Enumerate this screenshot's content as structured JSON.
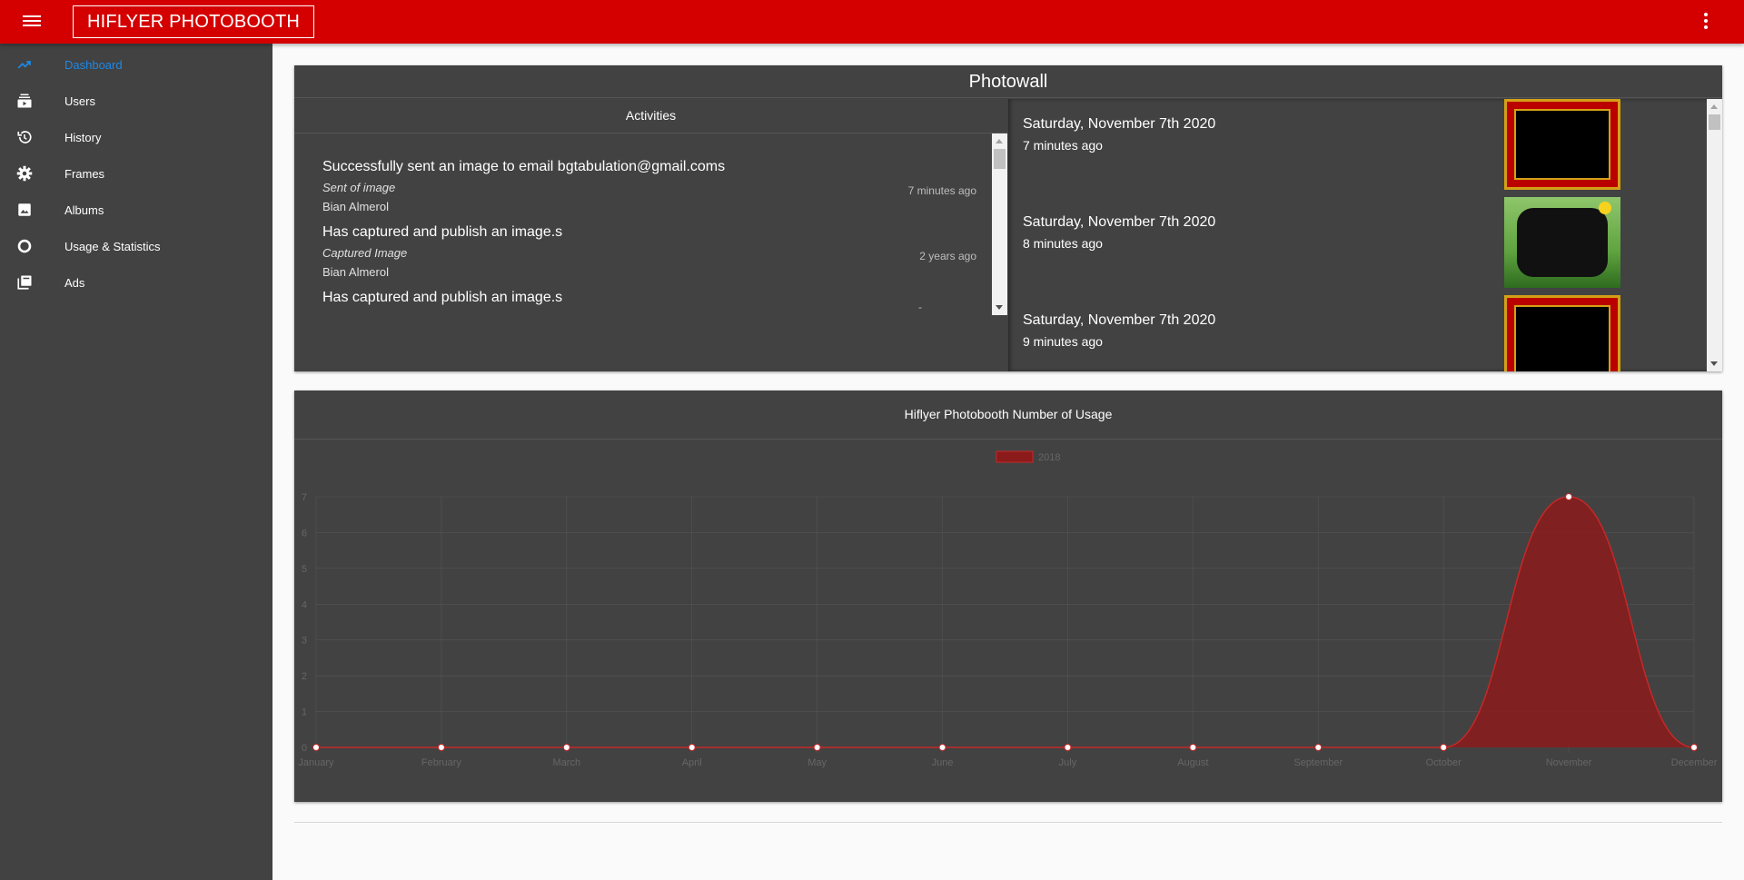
{
  "header": {
    "title": "HIFLYER PHOTOBOOTH"
  },
  "sidebar": {
    "items": [
      {
        "label": "Dashboard",
        "icon": "trending-up-icon",
        "active": true
      },
      {
        "label": "Users",
        "icon": "subscriptions-icon"
      },
      {
        "label": "History",
        "icon": "history-icon"
      },
      {
        "label": "Frames",
        "icon": "gear-icon"
      },
      {
        "label": "Albums",
        "icon": "image-icon"
      },
      {
        "label": "Usage & Statistics",
        "icon": "ring-icon"
      },
      {
        "label": "Ads",
        "icon": "library-icon"
      }
    ]
  },
  "photowall": {
    "title": "Photowall",
    "activities": {
      "heading": "Activities",
      "items": [
        {
          "title": "Successfully sent an image to email bgtabulation@gmail.coms",
          "type": "Sent of image",
          "user": "Bian Almerol",
          "time": "7 minutes ago"
        },
        {
          "title": "Has captured and publish an image.s",
          "type": "Captured Image",
          "user": "Bian Almerol",
          "time": "2 years ago"
        },
        {
          "title": "Has captured and publish an image.s",
          "type": "",
          "user": "",
          "time": "-"
        }
      ]
    },
    "feed": [
      {
        "date": "Saturday, November 7th 2020",
        "ago": "7 minutes ago",
        "frame": "red-gold-frame"
      },
      {
        "date": "Saturday, November 7th 2020",
        "ago": "8 minutes ago",
        "frame": "nature-bunny-frame"
      },
      {
        "date": "Saturday, November 7th 2020",
        "ago": "9 minutes ago",
        "frame": "red-gold-frame"
      }
    ]
  },
  "usage_chart": {
    "title": "Hiflyer Photobooth Number of Usage"
  },
  "chart_data": {
    "type": "area",
    "title": "Hiflyer Photobooth Number of Usage",
    "categories": [
      "January",
      "February",
      "March",
      "April",
      "May",
      "June",
      "July",
      "August",
      "September",
      "October",
      "November",
      "December"
    ],
    "series": [
      {
        "name": "2018",
        "values": [
          0,
          0,
          0,
          0,
          0,
          0,
          0,
          0,
          0,
          0,
          7,
          0
        ],
        "color": "#8b1a1a"
      }
    ],
    "ylim": [
      0,
      7
    ],
    "yticks": [
      0,
      1,
      2,
      3,
      4,
      5,
      6,
      7
    ],
    "legend": "top-center",
    "grid": true
  },
  "colors": {
    "accent": "#d40000",
    "sidebar": "#424242",
    "card": "#424242",
    "active_link": "#1e88e5"
  }
}
